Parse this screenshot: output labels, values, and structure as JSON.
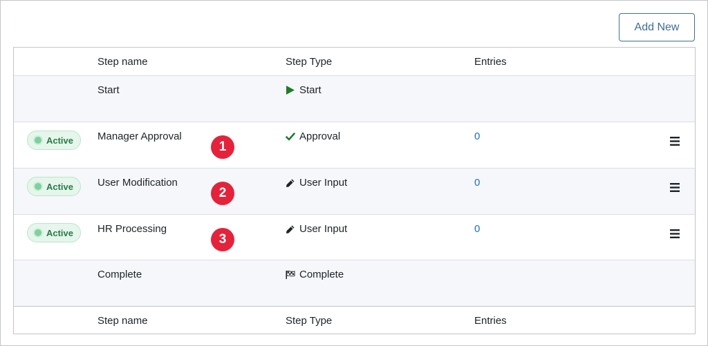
{
  "toolbar": {
    "add_new_label": "Add New"
  },
  "columns": {
    "name": "Step name",
    "type": "Step Type",
    "entries": "Entries"
  },
  "rows": [
    {
      "name": "Start",
      "type": "Start",
      "type_icon": "play-icon"
    },
    {
      "status": "Active",
      "name": "Manager Approval",
      "type": "Approval",
      "type_icon": "checkmark-icon",
      "entries": "0",
      "number": "1"
    },
    {
      "status": "Active",
      "name": "User Modification",
      "type": "User Input",
      "type_icon": "pencil-icon",
      "entries": "0",
      "number": "2"
    },
    {
      "status": "Active",
      "name": "HR Processing",
      "type": "User Input",
      "type_icon": "pencil-icon",
      "entries": "0",
      "number": "3"
    },
    {
      "name": "Complete",
      "type": "Complete",
      "type_icon": "checkered-flag-icon"
    }
  ],
  "colors": {
    "accent": "#3e6e93",
    "link": "#2271b1",
    "badge_text": "#2a7b46",
    "marker": "#e4233b",
    "start_icon": "#1e7d2b"
  }
}
